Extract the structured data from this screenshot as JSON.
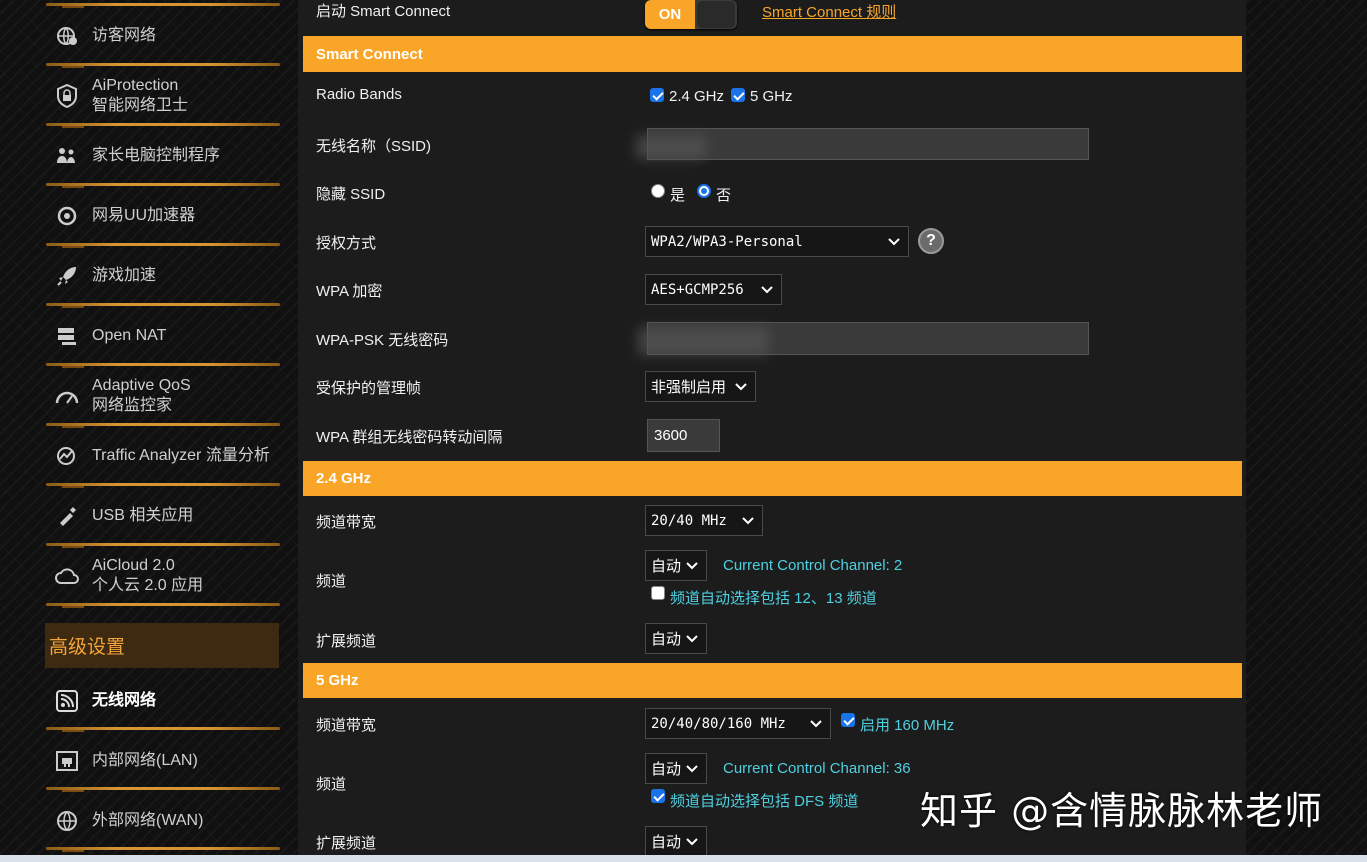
{
  "sidebar": {
    "items": [
      {
        "id": "guest-network",
        "label": "访客网络",
        "icon": "globe-guest-icon"
      },
      {
        "id": "aiprotection",
        "label": "AiProtection",
        "label2": "智能网络卫士",
        "icon": "shield-lock-icon"
      },
      {
        "id": "parental",
        "label": "家长电脑控制程序",
        "icon": "family-icon"
      },
      {
        "id": "uu",
        "label": "网易UU加速器",
        "icon": "uu-icon"
      },
      {
        "id": "game-boost",
        "label": "游戏加速",
        "icon": "rocket-icon"
      },
      {
        "id": "open-nat",
        "label": "Open NAT",
        "icon": "nat-icon"
      },
      {
        "id": "qos",
        "label": "Adaptive QoS",
        "label2": "网络监控家",
        "icon": "gauge-icon"
      },
      {
        "id": "traffic",
        "label": "Traffic Analyzer 流量分析",
        "icon": "traffic-analyzer-icon"
      },
      {
        "id": "usb",
        "label": "USB 相关应用",
        "icon": "usb-icon"
      },
      {
        "id": "aicloud",
        "label": "AiCloud 2.0",
        "label2": "个人云 2.0 应用",
        "icon": "cloud-icon"
      }
    ],
    "advanced_header": "高级设置",
    "advanced_items": [
      {
        "id": "wireless",
        "label": "无线网络",
        "icon": "wifi-icon",
        "active": true
      },
      {
        "id": "lan",
        "label": "内部网络(LAN)",
        "icon": "lan-icon"
      },
      {
        "id": "wan",
        "label": "外部网络(WAN)",
        "icon": "wan-globe-icon"
      }
    ]
  },
  "main": {
    "smart_connect_label": "启动 Smart Connect",
    "toggle_label": "ON",
    "smart_connect_rule_link": "Smart Connect 规则",
    "section_smart_connect": "Smart Connect",
    "radio_bands_label": "Radio Bands",
    "band_24": "2.4 GHz",
    "band_5": "5 GHz",
    "ssid_label": "无线名称（SSID)",
    "hide_ssid_label": "隐藏 SSID",
    "hide_yes": "是",
    "hide_no": "否",
    "auth_label": "授权方式",
    "auth_value": "WPA2/WPA3-Personal",
    "help_glyph": "?",
    "wpa_enc_label": "WPA 加密",
    "wpa_enc_value": "AES+GCMP256",
    "psk_label": "WPA-PSK 无线密码",
    "pmf_label": "受保护的管理帧",
    "pmf_value": "非强制启用",
    "rekey_label": "WPA 群组无线密码转动间隔",
    "rekey_value": "3600",
    "section_24": "2.4 GHz",
    "bw24_label": "频道带宽",
    "bw24_value": "20/40 MHz",
    "ch24_label": "频道",
    "ch24_value": "自动",
    "ch24_current": "Current Control Channel: 2",
    "ch24_option": "频道自动选择包括 12、13 频道",
    "ext24_label": "扩展频道",
    "ext24_value": "自动",
    "section_5": "5 GHz",
    "bw5_label": "频道带宽",
    "bw5_value": "20/40/80/160 MHz",
    "bw5_enable160": "启用 160 MHz",
    "ch5_label": "频道",
    "ch5_value": "自动",
    "ch5_current": "Current Control Channel: 36",
    "ch5_option": "频道自动选择包括 DFS 频道",
    "ext5_label": "扩展频道",
    "ext5_value": "自动"
  },
  "watermark": "知乎 @含情脉脉林老师",
  "colors": {
    "accent": "#f9a628",
    "cyan_text": "#4fd0e0",
    "checkbox_blue": "#1a73e8"
  }
}
